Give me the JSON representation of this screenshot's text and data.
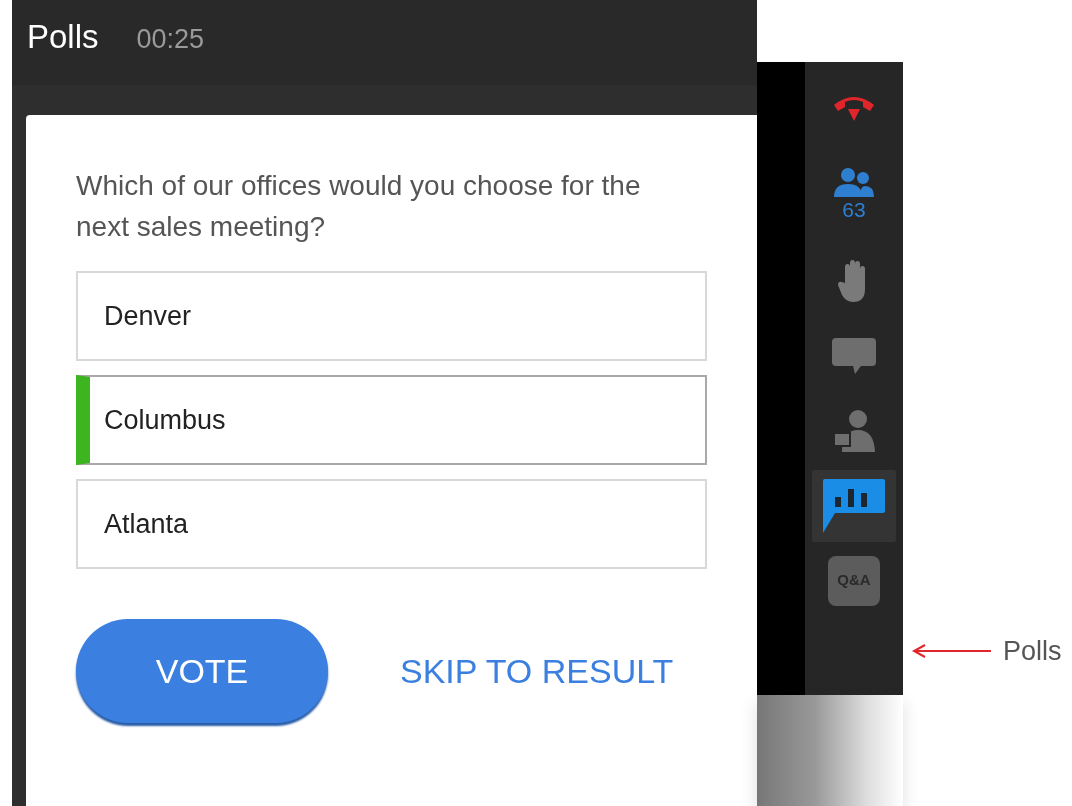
{
  "panel": {
    "title": "Polls",
    "timer": "00:25"
  },
  "poll": {
    "question": "Which of our offices would you choose for the next sales meeting?",
    "options": [
      {
        "label": "Denver",
        "selected": false
      },
      {
        "label": "Columbus",
        "selected": true
      },
      {
        "label": "Atlanta",
        "selected": false
      }
    ],
    "vote_button": "VOTE",
    "skip_link": "SKIP TO RESULT"
  },
  "sidebar": {
    "items": [
      {
        "kind": "hangup",
        "selected": false
      },
      {
        "kind": "participants",
        "count": "63",
        "selected": false
      },
      {
        "kind": "raise-hand",
        "selected": false
      },
      {
        "kind": "chat",
        "selected": false
      },
      {
        "kind": "presenter",
        "selected": false
      },
      {
        "kind": "polls",
        "selected": true
      },
      {
        "kind": "qa",
        "label": "Q&A",
        "selected": false
      }
    ]
  },
  "annotation": {
    "label": "Polls"
  }
}
